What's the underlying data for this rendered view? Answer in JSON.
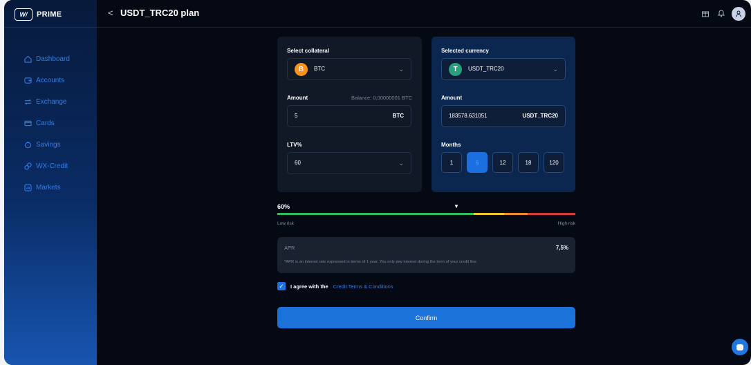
{
  "app": {
    "logo_mark": "W/",
    "logo_text": "PRIME"
  },
  "sidebar": {
    "items": [
      {
        "label": "Dashboard",
        "icon": "dashboard-icon"
      },
      {
        "label": "Accounts",
        "icon": "accounts-icon"
      },
      {
        "label": "Exchange",
        "icon": "exchange-icon"
      },
      {
        "label": "Cards",
        "icon": "cards-icon"
      },
      {
        "label": "Savings",
        "icon": "savings-icon"
      },
      {
        "label": "WX-Credit",
        "icon": "credit-icon"
      },
      {
        "label": "Markets",
        "icon": "markets-icon"
      }
    ]
  },
  "header": {
    "back": "<",
    "title": "USDT_TRC20 plan",
    "icons": [
      "gift-icon",
      "bell-icon",
      "user-icon"
    ]
  },
  "left_card": {
    "collateral_label": "Select collateral",
    "collateral_value": "BTC",
    "collateral_coin_symbol": "B",
    "amount_label": "Amount",
    "balance_text": "Balance: 0,00000001 BTC",
    "amount_value": "5",
    "amount_unit": "BTC",
    "ltv_label": "LTV%",
    "ltv_value": "60"
  },
  "right_card": {
    "currency_label": "Selected currency",
    "currency_value": "USDT_TRC20",
    "currency_coin_symbol": "T",
    "amount_label": "Amount",
    "amount_value": "183578.631051",
    "amount_unit": "USDT_TRC20",
    "months_label": "Months",
    "months": [
      "1",
      "6",
      "12",
      "18",
      "120"
    ],
    "selected_month": "6"
  },
  "risk": {
    "value": "60%",
    "marker": "▼",
    "low": "Low risk",
    "high": "High risk"
  },
  "apr": {
    "label": "APR",
    "value": "7,5%",
    "note": "*APR is an interest rate expressed in terms of 1 year. You only pay interest during the term of your credit line."
  },
  "agree": {
    "checked": true,
    "text": "I agree with the",
    "link": "Credit Terms & Conditions"
  },
  "confirm": {
    "label": "Confirm"
  },
  "colors": {
    "accent": "#1b73da",
    "risk_green": "#2fbf5b",
    "risk_yellow": "#f0c530",
    "risk_orange": "#ee8a2c",
    "risk_red": "#d83a3a",
    "btc": "#f7931a",
    "usdt": "#26a17b"
  }
}
